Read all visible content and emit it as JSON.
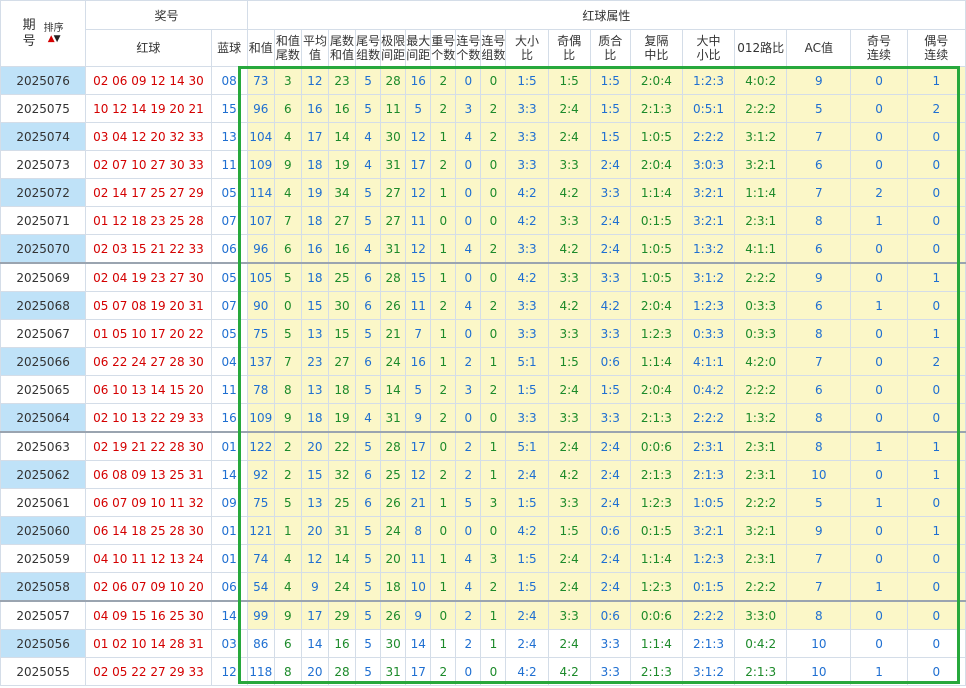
{
  "header": {
    "issue_label": "期\n号",
    "sort_label": "排序",
    "prize_label": "奖号",
    "red_label": "红球",
    "blue_label": "蓝球",
    "attr_label": "红球属性",
    "columns": [
      "和值",
      "和值尾数",
      "平均值",
      "尾数和值",
      "尾号组数",
      "极限间距",
      "最大间距",
      "重号个数",
      "连号个数",
      "连号组数",
      "大小比",
      "奇偶比",
      "质合比",
      "复隔中比",
      "大中小比",
      "012路比",
      "AC值",
      "奇号连续",
      "偶号连续"
    ]
  },
  "rows": [
    {
      "issue": "2025076",
      "red": "02 06 09 12 14 30",
      "blue": "08",
      "v": [
        "73",
        "3",
        "12",
        "23",
        "5",
        "28",
        "16",
        "2",
        "0",
        "0",
        "1:5",
        "1:5",
        "1:5",
        "2:0:4",
        "1:2:3",
        "4:0:2",
        "9",
        "0",
        "1"
      ]
    },
    {
      "issue": "2025075",
      "red": "10 12 14 19 20 21",
      "blue": "15",
      "v": [
        "96",
        "6",
        "16",
        "16",
        "5",
        "11",
        "5",
        "2",
        "3",
        "2",
        "3:3",
        "2:4",
        "1:5",
        "2:1:3",
        "0:5:1",
        "2:2:2",
        "5",
        "0",
        "2"
      ]
    },
    {
      "issue": "2025074",
      "red": "03 04 12 20 32 33",
      "blue": "13",
      "v": [
        "104",
        "4",
        "17",
        "14",
        "4",
        "30",
        "12",
        "1",
        "4",
        "2",
        "3:3",
        "2:4",
        "1:5",
        "1:0:5",
        "2:2:2",
        "3:1:2",
        "7",
        "0",
        "0"
      ]
    },
    {
      "issue": "2025073",
      "red": "02 07 10 27 30 33",
      "blue": "11",
      "v": [
        "109",
        "9",
        "18",
        "19",
        "4",
        "31",
        "17",
        "2",
        "0",
        "0",
        "3:3",
        "3:3",
        "2:4",
        "2:0:4",
        "3:0:3",
        "3:2:1",
        "6",
        "0",
        "0"
      ]
    },
    {
      "issue": "2025072",
      "red": "02 14 17 25 27 29",
      "blue": "05",
      "v": [
        "114",
        "4",
        "19",
        "34",
        "5",
        "27",
        "12",
        "1",
        "0",
        "0",
        "4:2",
        "4:2",
        "3:3",
        "1:1:4",
        "3:2:1",
        "1:1:4",
        "7",
        "2",
        "0"
      ]
    },
    {
      "issue": "2025071",
      "red": "01 12 18 23 25 28",
      "blue": "07",
      "v": [
        "107",
        "7",
        "18",
        "27",
        "5",
        "27",
        "11",
        "0",
        "0",
        "0",
        "4:2",
        "3:3",
        "2:4",
        "0:1:5",
        "3:2:1",
        "2:3:1",
        "8",
        "1",
        "0"
      ]
    },
    {
      "issue": "2025070",
      "red": "02 03 15 21 22 33",
      "blue": "06",
      "v": [
        "96",
        "6",
        "16",
        "16",
        "4",
        "31",
        "12",
        "1",
        "4",
        "2",
        "3:3",
        "4:2",
        "2:4",
        "1:0:5",
        "1:3:2",
        "4:1:1",
        "6",
        "0",
        "0"
      ]
    },
    {
      "issue": "2025069",
      "red": "02 04 19 23 27 30",
      "blue": "05",
      "v": [
        "105",
        "5",
        "18",
        "25",
        "6",
        "28",
        "15",
        "1",
        "0",
        "0",
        "4:2",
        "3:3",
        "3:3",
        "1:0:5",
        "3:1:2",
        "2:2:2",
        "9",
        "0",
        "1"
      ]
    },
    {
      "issue": "2025068",
      "red": "05 07 08 19 20 31",
      "blue": "07",
      "v": [
        "90",
        "0",
        "15",
        "30",
        "6",
        "26",
        "11",
        "2",
        "4",
        "2",
        "3:3",
        "4:2",
        "4:2",
        "2:0:4",
        "1:2:3",
        "0:3:3",
        "6",
        "1",
        "0"
      ]
    },
    {
      "issue": "2025067",
      "red": "01 05 10 17 20 22",
      "blue": "05",
      "v": [
        "75",
        "5",
        "13",
        "15",
        "5",
        "21",
        "7",
        "1",
        "0",
        "0",
        "3:3",
        "3:3",
        "3:3",
        "1:2:3",
        "0:3:3",
        "0:3:3",
        "8",
        "0",
        "1"
      ]
    },
    {
      "issue": "2025066",
      "red": "06 22 24 27 28 30",
      "blue": "04",
      "v": [
        "137",
        "7",
        "23",
        "27",
        "6",
        "24",
        "16",
        "1",
        "2",
        "1",
        "5:1",
        "1:5",
        "0:6",
        "1:1:4",
        "4:1:1",
        "4:2:0",
        "7",
        "0",
        "2"
      ]
    },
    {
      "issue": "2025065",
      "red": "06 10 13 14 15 20",
      "blue": "11",
      "v": [
        "78",
        "8",
        "13",
        "18",
        "5",
        "14",
        "5",
        "2",
        "3",
        "2",
        "1:5",
        "2:4",
        "1:5",
        "2:0:4",
        "0:4:2",
        "2:2:2",
        "6",
        "0",
        "0"
      ]
    },
    {
      "issue": "2025064",
      "red": "02 10 13 22 29 33",
      "blue": "16",
      "v": [
        "109",
        "9",
        "18",
        "19",
        "4",
        "31",
        "9",
        "2",
        "0",
        "0",
        "3:3",
        "3:3",
        "3:3",
        "2:1:3",
        "2:2:2",
        "1:3:2",
        "8",
        "0",
        "0"
      ]
    },
    {
      "issue": "2025063",
      "red": "02 19 21 22 28 30",
      "blue": "01",
      "v": [
        "122",
        "2",
        "20",
        "22",
        "5",
        "28",
        "17",
        "0",
        "2",
        "1",
        "5:1",
        "2:4",
        "2:4",
        "0:0:6",
        "2:3:1",
        "2:3:1",
        "8",
        "1",
        "1"
      ]
    },
    {
      "issue": "2025062",
      "red": "06 08 09 13 25 31",
      "blue": "14",
      "v": [
        "92",
        "2",
        "15",
        "32",
        "6",
        "25",
        "12",
        "2",
        "2",
        "1",
        "2:4",
        "4:2",
        "2:4",
        "2:1:3",
        "2:1:3",
        "2:3:1",
        "10",
        "0",
        "1"
      ]
    },
    {
      "issue": "2025061",
      "red": "06 07 09 10 11 32",
      "blue": "09",
      "v": [
        "75",
        "5",
        "13",
        "25",
        "6",
        "26",
        "21",
        "1",
        "5",
        "3",
        "1:5",
        "3:3",
        "2:4",
        "1:2:3",
        "1:0:5",
        "2:2:2",
        "5",
        "1",
        "0"
      ]
    },
    {
      "issue": "2025060",
      "red": "06 14 18 25 28 30",
      "blue": "01",
      "v": [
        "121",
        "1",
        "20",
        "31",
        "5",
        "24",
        "8",
        "0",
        "0",
        "0",
        "4:2",
        "1:5",
        "0:6",
        "0:1:5",
        "3:2:1",
        "3:2:1",
        "9",
        "0",
        "1"
      ]
    },
    {
      "issue": "2025059",
      "red": "04 10 11 12 13 24",
      "blue": "01",
      "v": [
        "74",
        "4",
        "12",
        "14",
        "5",
        "20",
        "11",
        "1",
        "4",
        "3",
        "1:5",
        "2:4",
        "2:4",
        "1:1:4",
        "1:2:3",
        "2:3:1",
        "7",
        "0",
        "0"
      ]
    },
    {
      "issue": "2025058",
      "red": "02 06 07 09 10 20",
      "blue": "06",
      "v": [
        "54",
        "4",
        "9",
        "24",
        "5",
        "18",
        "10",
        "1",
        "4",
        "2",
        "1:5",
        "2:4",
        "2:4",
        "1:2:3",
        "0:1:5",
        "2:2:2",
        "7",
        "1",
        "0"
      ]
    },
    {
      "issue": "2025057",
      "red": "04 09 15 16 25 30",
      "blue": "14",
      "v": [
        "99",
        "9",
        "17",
        "29",
        "5",
        "26",
        "9",
        "0",
        "2",
        "1",
        "2:4",
        "3:3",
        "0:6",
        "0:0:6",
        "2:2:2",
        "3:3:0",
        "8",
        "0",
        "0"
      ]
    },
    {
      "issue": "2025056",
      "red": "01 02 10 14 28 31",
      "blue": "03",
      "v": [
        "86",
        "6",
        "14",
        "16",
        "5",
        "30",
        "14",
        "1",
        "2",
        "1",
        "2:4",
        "2:4",
        "3:3",
        "1:1:4",
        "2:1:3",
        "0:4:2",
        "10",
        "0",
        "0"
      ]
    },
    {
      "issue": "2025055",
      "red": "02 05 22 27 29 33",
      "blue": "12",
      "v": [
        "118",
        "8",
        "20",
        "28",
        "5",
        "31",
        "17",
        "2",
        "0",
        "0",
        "4:2",
        "4:2",
        "3:3",
        "2:1:3",
        "3:1:2",
        "2:1:3",
        "10",
        "1",
        "0"
      ]
    }
  ]
}
